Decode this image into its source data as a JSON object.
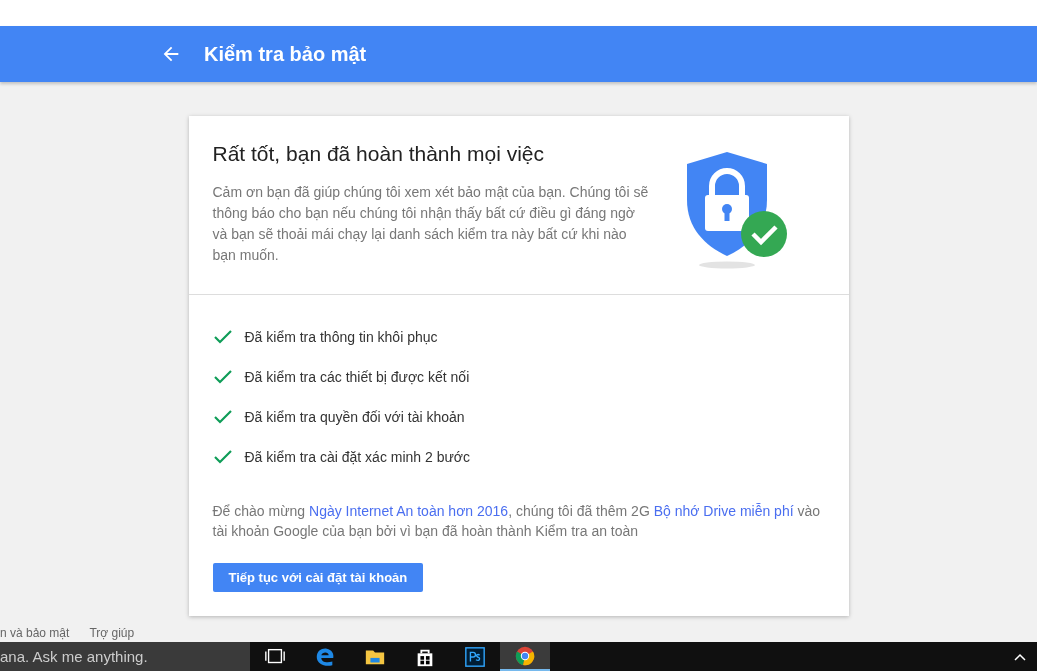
{
  "header": {
    "title": "Kiểm tra bảo mật"
  },
  "card": {
    "heading": "Rất tốt, bạn đã hoàn thành mọi việc",
    "description": "Cảm ơn bạn đã giúp chúng tôi xem xét bảo mật của bạn. Chúng tôi sẽ thông báo cho bạn nếu chúng tôi nhận thấy bất cứ điều gì đáng ngờ và bạn sẽ thoải mái chạy lại danh sách kiểm tra này bất cứ khi nào bạn muốn.",
    "checks": [
      {
        "label": "Đã kiểm tra thông tin khôi phục",
        "checked": true
      },
      {
        "label": "Đã kiểm tra các thiết bị được kết nối",
        "checked": true
      },
      {
        "label": "Đã kiểm tra quyền đối với tài khoản",
        "checked": true
      },
      {
        "label": "Đã kiểm tra cài đặt xác minh 2 bước",
        "checked": true
      }
    ],
    "promo": [
      {
        "kind": "text",
        "text": "Để chào mừng "
      },
      {
        "kind": "link",
        "text": "Ngày Internet An toàn hơn 2016"
      },
      {
        "kind": "text",
        "text": ", chúng tôi đã thêm 2G "
      },
      {
        "kind": "link",
        "text": "Bộ nhớ Drive miễn phí"
      },
      {
        "kind": "text",
        "text": " vào tài khoản Google của bạn bởi vì bạn đã hoàn thành Kiểm tra an toàn"
      }
    ],
    "button": "Tiếp tục với cài đặt tài khoản"
  },
  "footer_links": [
    "n và bảo mật",
    "Trợ giúp"
  ],
  "taskbar": {
    "search_placeholder": "ana. Ask me anything.",
    "apps": [
      {
        "kind": "taskview",
        "selected": false
      },
      {
        "kind": "edge",
        "selected": false
      },
      {
        "kind": "folder",
        "selected": false
      },
      {
        "kind": "store",
        "selected": false
      },
      {
        "kind": "ps",
        "selected": false
      },
      {
        "kind": "chrome",
        "selected": true
      }
    ]
  }
}
